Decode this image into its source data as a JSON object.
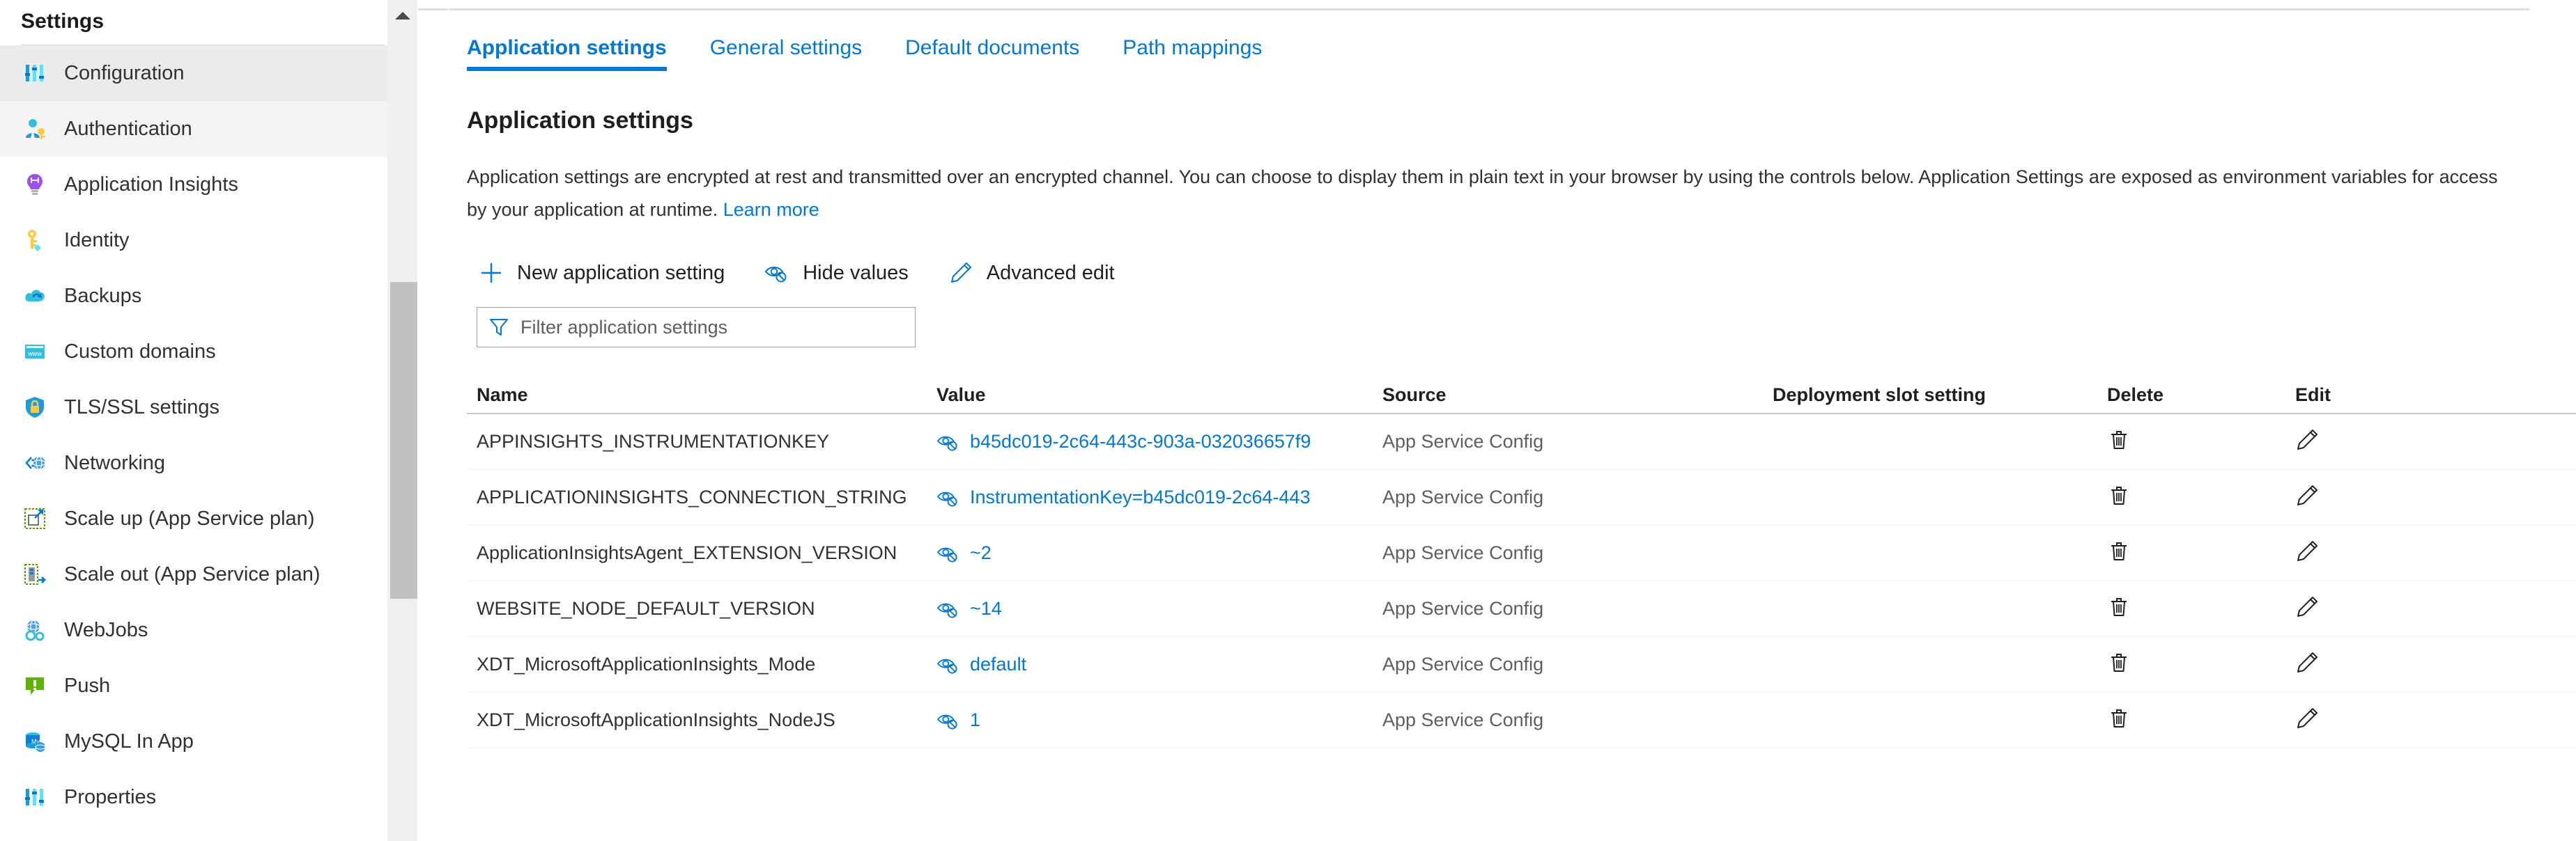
{
  "sidebar": {
    "title": "Settings",
    "items": [
      {
        "label": "Configuration",
        "icon": "sliders-icon",
        "state": "selected"
      },
      {
        "label": "Authentication",
        "icon": "user-key-icon",
        "state": "hovered"
      },
      {
        "label": "Application Insights",
        "icon": "lightbulb-icon",
        "state": "normal"
      },
      {
        "label": "Identity",
        "icon": "key-icon",
        "state": "normal"
      },
      {
        "label": "Backups",
        "icon": "cloud-backup-icon",
        "state": "normal"
      },
      {
        "label": "Custom domains",
        "icon": "www-window-icon",
        "state": "normal"
      },
      {
        "label": "TLS/SSL settings",
        "icon": "shield-lock-icon",
        "state": "normal"
      },
      {
        "label": "Networking",
        "icon": "network-globe-icon",
        "state": "normal"
      },
      {
        "label": "Scale up (App Service plan)",
        "icon": "scale-up-icon",
        "state": "normal"
      },
      {
        "label": "Scale out (App Service plan)",
        "icon": "scale-out-icon",
        "state": "normal"
      },
      {
        "label": "WebJobs",
        "icon": "webjobs-gear-icon",
        "state": "normal"
      },
      {
        "label": "Push",
        "icon": "push-alert-icon",
        "state": "normal"
      },
      {
        "label": "MySQL In App",
        "icon": "mysql-db-icon",
        "state": "normal"
      },
      {
        "label": "Properties",
        "icon": "sliders-icon",
        "state": "normal"
      }
    ],
    "scrollbar": {
      "up_arrow": "chevron-up-icon"
    }
  },
  "tabs": [
    {
      "label": "Application settings",
      "active": true
    },
    {
      "label": "General settings",
      "active": false
    },
    {
      "label": "Default documents",
      "active": false
    },
    {
      "label": "Path mappings",
      "active": false
    }
  ],
  "page": {
    "title": "Application settings",
    "description_part1": "Application settings are encrypted at rest and transmitted over an encrypted channel. You can choose to display them in plain text in your browser by using the controls below. Application Settings are exposed as environment variables for access by your application at runtime. ",
    "learn_more": "Learn more"
  },
  "toolbar": {
    "new_setting": {
      "label": "New application setting",
      "icon": "plus-icon"
    },
    "hide_values": {
      "label": "Hide values",
      "icon": "eye-slash-icon"
    },
    "advanced_edit": {
      "label": "Advanced edit",
      "icon": "pencil-icon"
    }
  },
  "filter": {
    "placeholder": "Filter application settings",
    "value": "",
    "icon": "funnel-icon"
  },
  "table": {
    "headers": {
      "name": "Name",
      "value": "Value",
      "source": "Source",
      "slot": "Deployment slot setting",
      "delete": "Delete",
      "edit": "Edit"
    },
    "rows": [
      {
        "name": "APPINSIGHTS_INSTRUMENTATIONKEY",
        "value": "b45dc019-2c64-443c-903a-032036657f9",
        "source": "App Service Config",
        "slot": "",
        "delete_icon": "trash-icon",
        "edit_icon": "pencil-icon",
        "value_icon": "eye-slash-icon"
      },
      {
        "name": "APPLICATIONINSIGHTS_CONNECTION_STRING",
        "value": "InstrumentationKey=b45dc019-2c64-443",
        "source": "App Service Config",
        "slot": "",
        "delete_icon": "trash-icon",
        "edit_icon": "pencil-icon",
        "value_icon": "eye-slash-icon"
      },
      {
        "name": "ApplicationInsightsAgent_EXTENSION_VERSION",
        "value": "~2",
        "source": "App Service Config",
        "slot": "",
        "delete_icon": "trash-icon",
        "edit_icon": "pencil-icon",
        "value_icon": "eye-slash-icon"
      },
      {
        "name": "WEBSITE_NODE_DEFAULT_VERSION",
        "value": "~14",
        "source": "App Service Config",
        "slot": "",
        "delete_icon": "trash-icon",
        "edit_icon": "pencil-icon",
        "value_icon": "eye-slash-icon"
      },
      {
        "name": "XDT_MicrosoftApplicationInsights_Mode",
        "value": "default",
        "source": "App Service Config",
        "slot": "",
        "delete_icon": "trash-icon",
        "edit_icon": "pencil-icon",
        "value_icon": "eye-slash-icon"
      },
      {
        "name": "XDT_MicrosoftApplicationInsights_NodeJS",
        "value": "1",
        "source": "App Service Config",
        "slot": "",
        "delete_icon": "trash-icon",
        "edit_icon": "pencil-icon",
        "value_icon": "eye-slash-icon"
      }
    ]
  },
  "colors": {
    "accent": "#0078d4",
    "selected_nav": "#ebebeb",
    "hover_nav": "#f4f4f4",
    "text": "#323130",
    "muted": "#605e5c"
  }
}
